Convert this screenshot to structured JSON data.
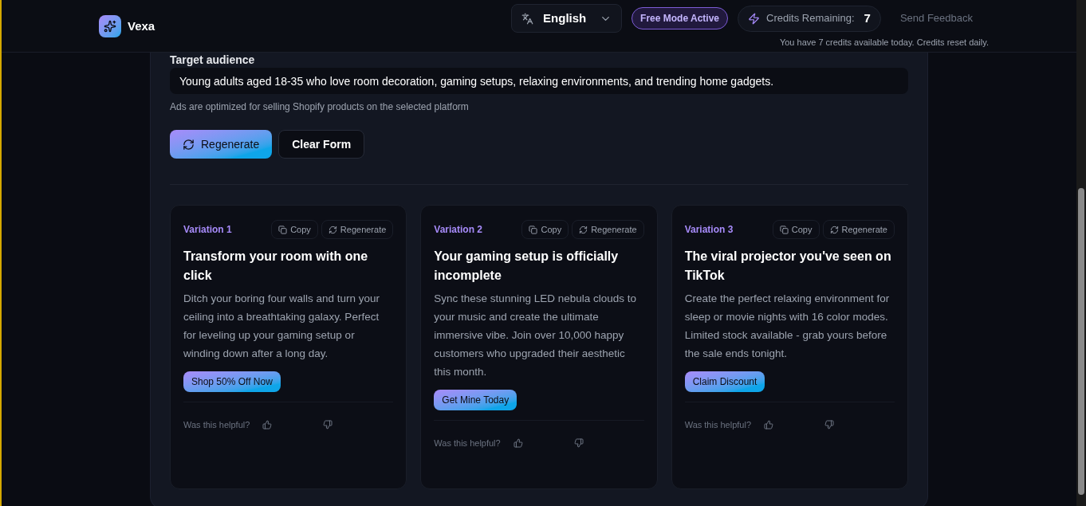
{
  "header": {
    "logo": "Vexa",
    "language": "English",
    "mode_badge": "Free Mode Active",
    "credits_label": "Credits Remaining:",
    "credits_value": "7",
    "feedback": "Send Feedback",
    "credits_note": "You have 7 credits available today. Credits reset daily."
  },
  "form": {
    "label": "Target audience",
    "value": "Young adults aged 18-35 who love room decoration, gaming setups, relaxing environments, and trending home gadgets.",
    "hint": "Ads are optimized for selling Shopify products on the selected platform"
  },
  "actions": [
    {
      "kind": "primary",
      "label": "Regenerate"
    },
    {
      "kind": "secondary",
      "label": "Clear Form"
    }
  ],
  "variations": [
    {
      "label": "Variation 1",
      "copy": "Copy",
      "regenerate": "Regenerate",
      "headline": "Transform your room with one click",
      "body": "Ditch your boring four walls and turn your ceiling into a breathtaking galaxy. Perfect for leveling up your gaming setup or winding down after a long day.",
      "cta": "Shop 50% Off Now",
      "helpful": "Was this helpful?"
    },
    {
      "label": "Variation 2",
      "copy": "Copy",
      "regenerate": "Regenerate",
      "headline": "Your gaming setup is officially incomplete",
      "body": "Sync these stunning LED nebula clouds to your music and create the ultimate immersive vibe. Join over 10,000 happy customers who upgraded their aesthetic this month.",
      "cta": "Get Mine Today",
      "helpful": "Was this helpful?"
    },
    {
      "label": "Variation 3",
      "copy": "Copy",
      "regenerate": "Regenerate",
      "headline": "The viral projector you've seen on TikTok",
      "body": "Create the perfect relaxing environment for sleep or movie nights with 16 color modes. Limited stock available - grab yours before the sale ends tonight.",
      "cta": "Claim Discount",
      "helpful": "Was this helpful?"
    }
  ]
}
